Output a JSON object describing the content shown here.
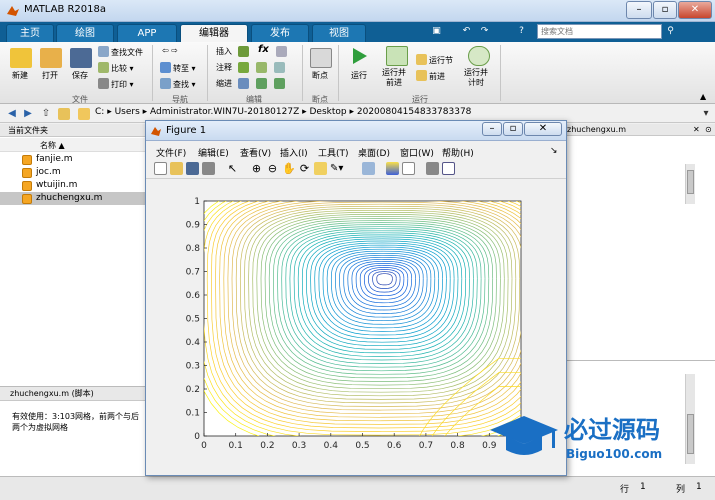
{
  "window": {
    "title": "MATLAB R2018a"
  },
  "tabs": [
    {
      "label": "主页",
      "active": false
    },
    {
      "label": "绘图",
      "active": false
    },
    {
      "label": "APP",
      "active": false
    },
    {
      "label": "编辑器",
      "active": true
    },
    {
      "label": "发布",
      "active": false
    },
    {
      "label": "视图",
      "active": false
    }
  ],
  "search": {
    "placeholder": "搜索文档"
  },
  "ribbon": {
    "file_group": {
      "label": "文件",
      "new": "新建",
      "open": "打开",
      "save": "保存",
      "find_files": "查找文件",
      "compare": "比较",
      "print": "打印"
    },
    "nav_group": {
      "label": "导航",
      "goto": "转至",
      "find": "查找"
    },
    "edit_group": {
      "label": "编辑",
      "insert": "插入",
      "comment": "注释",
      "indent": "缩进",
      "fx": "fx"
    },
    "breakpoint_group": {
      "label": "断点",
      "breakpoints": "断点"
    },
    "run_group": {
      "label": "运行",
      "run": "运行",
      "run_advance": "运行并\n前进",
      "run_section": "运行节",
      "advance": "前进",
      "run_time": "运行并\n计时"
    }
  },
  "address": {
    "crumbs": [
      "C:",
      "Users",
      "Administrator.WIN7U-20180127Z",
      "Desktop",
      "20200804154833783378"
    ]
  },
  "current_folder": {
    "title": "当前文件夹",
    "column_name": "名称 ▲",
    "files": [
      {
        "name": "fanjie.m",
        "selected": false
      },
      {
        "name": "joc.m",
        "selected": false
      },
      {
        "name": "wtuijin.m",
        "selected": false
      },
      {
        "name": "zhuchengxu.m",
        "selected": true
      }
    ]
  },
  "details": {
    "title": "zhuchengxu.m  (脚本)",
    "text_line1": "有效使用：3:103网格，前两个与后",
    "text_line2": "两个为虚拟网格"
  },
  "right_panel": {
    "tab": "zhuchengxu.m"
  },
  "status": {
    "row_label": "行",
    "row_value": "1",
    "col_label": "列",
    "col_value": "1"
  },
  "figure": {
    "title": "Figure 1",
    "menu": [
      "文件(F)",
      "编辑(E)",
      "查看(V)",
      "插入(I)",
      "工具(T)",
      "桌面(D)",
      "窗口(W)",
      "帮助(H)"
    ],
    "xticks": [
      "0",
      "0.1",
      "0.2",
      "0.3",
      "0.4",
      "0.5",
      "0.6",
      "0.7",
      "0.8",
      "0.9"
    ],
    "yticks": [
      "0",
      "0.1",
      "0.2",
      "0.3",
      "0.4",
      "0.5",
      "0.6",
      "0.7",
      "0.8",
      "0.9",
      "1"
    ]
  },
  "chart_data": {
    "type": "contour",
    "xlim": [
      0,
      1
    ],
    "ylim": [
      0,
      1
    ],
    "vortex_center": [
      0.57,
      0.67
    ],
    "colormap": "parula",
    "grid": false
  },
  "watermark": {
    "text": "必过源码",
    "url": "Biguo100.com"
  },
  "colors": {
    "ribbon_bar": "#0f5f95",
    "active_tab": "#f5f5f5",
    "selection": "#c6c6c6"
  }
}
